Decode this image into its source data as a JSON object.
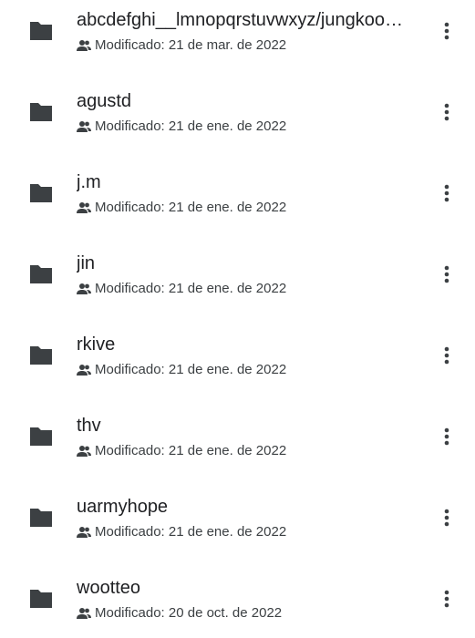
{
  "files": [
    {
      "name": "abcdefghi__lmnopqrstuvwxyz/jungkoo…",
      "meta": "Modificado: 21 de mar. de 2022",
      "icon": "folder-icon"
    },
    {
      "name": "agustd",
      "meta": "Modificado: 21 de ene. de 2022",
      "icon": "folder-icon"
    },
    {
      "name": "j.m",
      "meta": "Modificado: 21 de ene. de 2022",
      "icon": "folder-icon"
    },
    {
      "name": "jin",
      "meta": "Modificado: 21 de ene. de 2022",
      "icon": "folder-icon"
    },
    {
      "name": "rkive",
      "meta": "Modificado: 21 de ene. de 2022",
      "icon": "folder-icon"
    },
    {
      "name": "thv",
      "meta": "Modificado: 21 de ene. de 2022",
      "icon": "folder-icon"
    },
    {
      "name": "uarmyhope",
      "meta": "Modificado: 21 de ene. de 2022",
      "icon": "folder-icon"
    },
    {
      "name": "wootteo",
      "meta": "Modificado: 20 de oct. de 2022",
      "icon": "folder-icon"
    }
  ],
  "icons": {
    "shared": "people-icon",
    "more": "more-vert-icon"
  },
  "colors": {
    "icon": "#3c4043",
    "text": "#202124",
    "secondary": "#3c4043"
  }
}
